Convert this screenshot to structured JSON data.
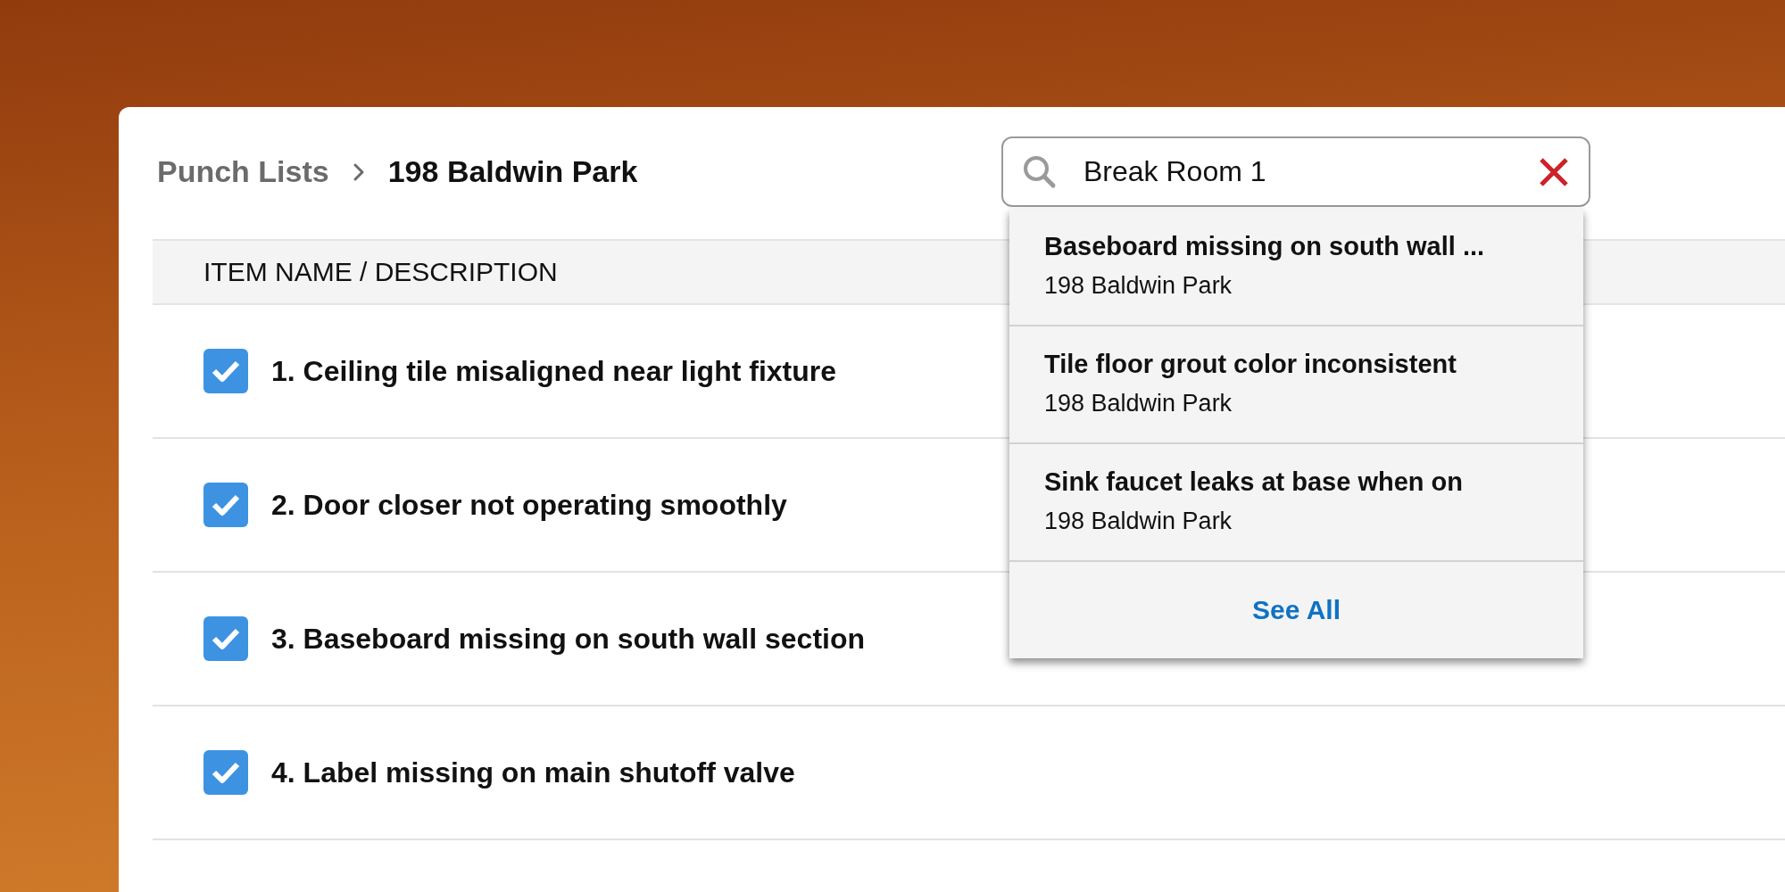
{
  "breadcrumb": [
    {
      "label": "Punch Lists",
      "current": false
    },
    {
      "label": "198 Baldwin Park",
      "current": true
    }
  ],
  "search": {
    "value": "Break Room 1"
  },
  "search_results": {
    "items": [
      {
        "title": "Baseboard missing on south wall ...",
        "subtitle": "198 Baldwin Park"
      },
      {
        "title": "Tile floor grout color inconsistent",
        "subtitle": "198 Baldwin Park"
      },
      {
        "title": "Sink faucet leaks at base when on",
        "subtitle": "198 Baldwin Park"
      }
    ],
    "see_all": "See All"
  },
  "table": {
    "columns": [
      "ITEM NAME / DESCRIPTION"
    ],
    "rows": [
      {
        "label": "1. Ceiling tile misaligned near light fixture",
        "checked": true
      },
      {
        "label": "2. Door closer not operating smoothly",
        "checked": true
      },
      {
        "label": "3. Baseboard missing on south wall section",
        "checked": true
      },
      {
        "label": "4. Label missing on main shutoff valve",
        "checked": true
      }
    ]
  }
}
